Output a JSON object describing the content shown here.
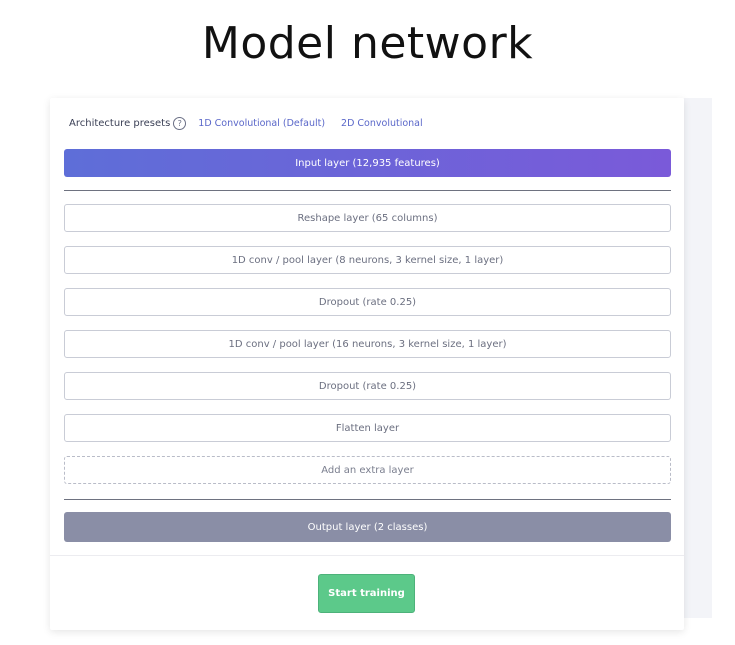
{
  "slide": {
    "title": "Model network"
  },
  "presets": {
    "label": "Architecture presets",
    "help_icon": "question-circle-icon",
    "options": [
      "1D Convolutional (Default)",
      "2D Convolutional"
    ]
  },
  "layers": {
    "input": "Input layer (12,935 features)",
    "items": [
      "Reshape layer (65 columns)",
      "1D conv / pool layer (8 neurons, 3 kernel size, 1 layer)",
      "Dropout (rate 0.25)",
      "1D conv / pool layer (16 neurons, 3 kernel size, 1 layer)",
      "Dropout (rate 0.25)",
      "Flatten layer"
    ],
    "add_extra": "Add an extra layer",
    "output": "Output layer (2 classes)"
  },
  "actions": {
    "start_training": "Start training"
  },
  "colors": {
    "input_gradient_start": "#5e6ed8",
    "input_gradient_end": "#7a5ad9",
    "output_bg": "#8a8ea6",
    "start_button": "#5cc98a",
    "preset_link": "#5a67c9"
  }
}
